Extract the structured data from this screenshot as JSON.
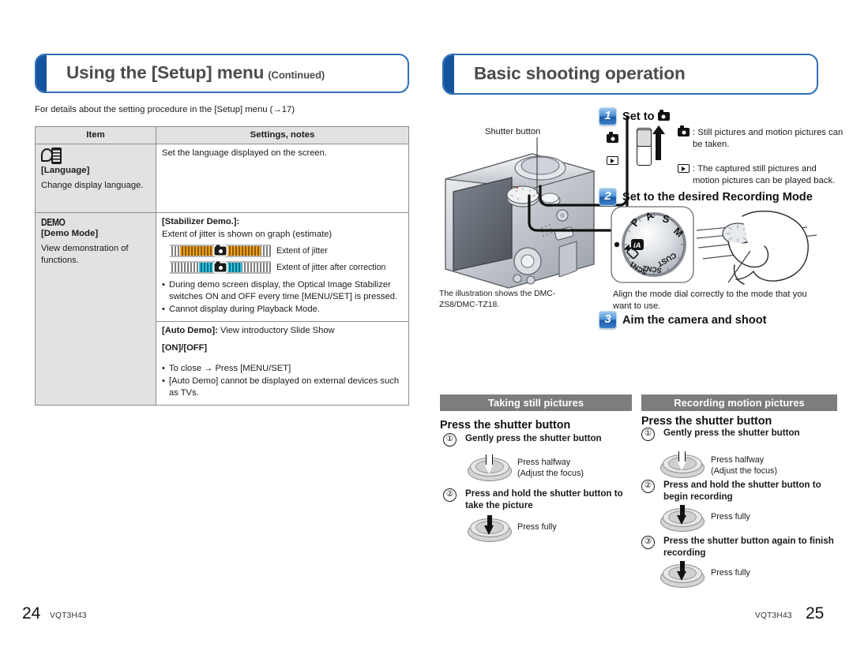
{
  "left_page": {
    "banner": {
      "title": "Using the [Setup] menu",
      "subtitle": "(Continued)",
      "accent_color": "#14549e",
      "border_color": "#2f6fb5"
    },
    "lead_line": "For details about the setting procedure in the [Setup] menu (→17)",
    "table": {
      "headers": [
        "Item",
        "Settings, notes"
      ],
      "rows": [
        {
          "icon": "language-icon",
          "item_name": "[Language]",
          "item_desc": "Change display language.",
          "notes_text": "Set the language displayed on the screen."
        },
        {
          "icon": "demo-badge",
          "icon_text": "DEMO",
          "item_name": "[Demo Mode]",
          "item_desc": "View demonstration of functions.",
          "notes_heading": "[Stabilizer Demo.]:",
          "notes_sub": "Extent of jitter is shown on graph (estimate)",
          "graphs": [
            {
              "label": "Extent of jitter",
              "band": "wide",
              "color": "#f0a21e"
            },
            {
              "label": "Extent of jitter after correction",
              "band": "narrow",
              "color": "#2fc3e0"
            }
          ],
          "bullets": [
            "During demo screen display, the Optical Image Stabilizer switches ON and OFF every time [MENU/SET] is pressed.",
            "Cannot display during Playback Mode."
          ],
          "sub_row": {
            "heading": "[Auto Demo]:",
            "heading_rest": " View introductory Slide Show",
            "options": "[ON]/[OFF]",
            "bullets": [
              "To close → Press [MENU/SET]",
              "[Auto Demo] cannot be displayed on external devices such as TVs."
            ]
          }
        }
      ]
    },
    "footer": {
      "page_number": "24",
      "code": "VQT3H43"
    }
  },
  "right_page": {
    "banner": {
      "title": "Basic shooting operation",
      "accent_color": "#14549e",
      "border_color": "#2f6fb5"
    },
    "camera_figure": {
      "callout_label": "Shutter button",
      "caption": "The illustration shows the DMC-ZS8/DMC-TZ18."
    },
    "steps": [
      {
        "number": "1",
        "title": "Set to",
        "title_icon": "camera-icon",
        "legend": [
          {
            "icon": "camera-icon",
            "text": ": Still pictures and motion pictures can be taken."
          },
          {
            "icon": "play-icon",
            "text": ": The captured still pictures and motion pictures can be played back."
          }
        ]
      },
      {
        "number": "2",
        "title": "Set to the desired Recording Mode",
        "dial_labels": [
          "P",
          "A",
          "S",
          "M",
          "CUST",
          "SCN2",
          "SCN1"
        ],
        "note": "Align the mode dial correctly to the mode that you want to use."
      },
      {
        "number": "3",
        "title": "Aim the camera and shoot"
      }
    ],
    "columns": [
      {
        "header": "Taking still pictures",
        "press_title": "Press the shutter button",
        "steps": [
          {
            "num": "①",
            "text": "Gently press the shutter button",
            "arrow": "hollow",
            "note_line1": "Press halfway",
            "note_line2": "(Adjust the focus)"
          },
          {
            "num": "②",
            "text": "Press and hold the shutter button to take the picture",
            "arrow": "solid",
            "note_line1": "Press fully",
            "note_line2": ""
          }
        ]
      },
      {
        "header": "Recording motion pictures",
        "press_title": "Press the shutter button",
        "steps": [
          {
            "num": "①",
            "text": "Gently press the shutter button",
            "arrow": "hollow",
            "note_line1": "Press halfway",
            "note_line2": "(Adjust the focus)"
          },
          {
            "num": "②",
            "text": "Press and hold the shutter button to begin recording",
            "arrow": "solid",
            "note_line1": "Press fully",
            "note_line2": ""
          },
          {
            "num": "③",
            "text": "Press the shutter button again to finish recording",
            "arrow": "solid",
            "note_line1": "Press fully",
            "note_line2": ""
          }
        ]
      }
    ],
    "section_bar_color": "#7d7d7d",
    "footer": {
      "page_number": "25",
      "code": "VQT3H43"
    }
  }
}
